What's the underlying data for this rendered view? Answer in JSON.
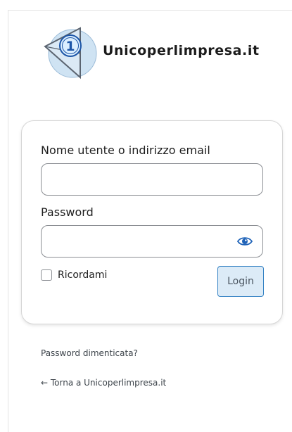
{
  "brand": {
    "site_name": "Unicoperlimpresa.it",
    "logo_digit": "1",
    "logo_icon": "numbered-triangle-logo-icon"
  },
  "form": {
    "username_label": "Nome utente o indirizzo email",
    "username_value": "",
    "password_label": "Password",
    "password_value": "",
    "show_password_icon": "eye-icon",
    "remember_label": "Ricordami",
    "remember_checked": false,
    "login_label": "Login"
  },
  "links": {
    "lost_password": "Password dimenticata?",
    "back_to_site": "← Torna a Unicoperlimpresa.it"
  },
  "colors": {
    "accent": "#3582c4",
    "button_bg": "#dcebf7",
    "eye": "#1f63b8"
  }
}
